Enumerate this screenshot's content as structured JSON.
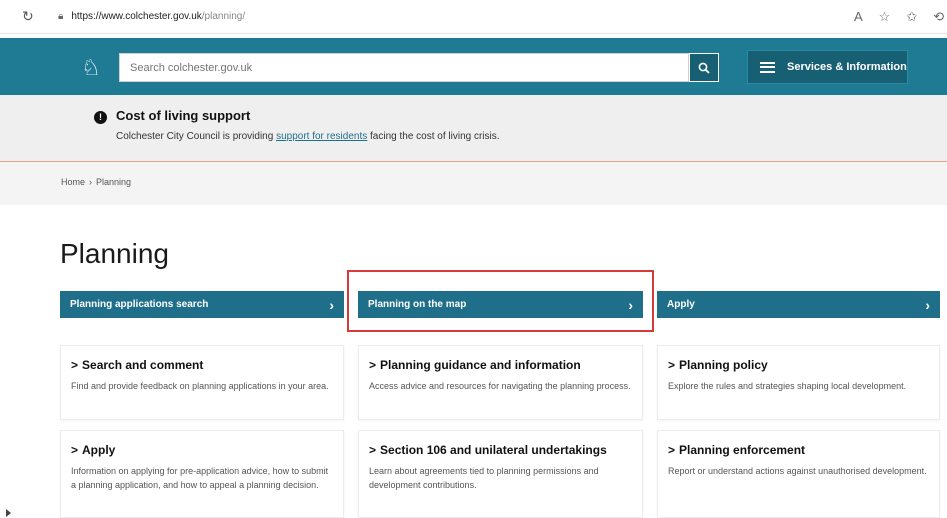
{
  "browser": {
    "url_host": "https://www.colchester.gov.uk",
    "url_path": "/planning/"
  },
  "header": {
    "search_placeholder": "Search colchester.gov.uk",
    "services_label": "Services & Information"
  },
  "alert": {
    "title": "Cost of living support",
    "text_before": "Colchester City Council is providing ",
    "link_text": "support for residents",
    "text_after": " facing the cost of living crisis."
  },
  "breadcrumb": {
    "home": "Home",
    "sep": "›",
    "current": "Planning"
  },
  "page": {
    "title": "Planning"
  },
  "bars": [
    {
      "label": "Planning applications search"
    },
    {
      "label": "Planning on the map"
    },
    {
      "label": "Apply"
    }
  ],
  "cards": [
    {
      "title": "Search and comment",
      "desc": "Find and provide feedback on planning applications in your area."
    },
    {
      "title": "Planning guidance and information",
      "desc": "Access advice and resources for navigating the planning process."
    },
    {
      "title": "Planning policy",
      "desc": "Explore the rules and strategies shaping local development."
    },
    {
      "title": "Apply",
      "desc": "Information on applying for pre-application advice, how to submit a planning application, and how to appeal a planning decision."
    },
    {
      "title": "Section 106 and unilateral undertakings",
      "desc": "Learn about agreements tied to planning permissions and development contributions."
    },
    {
      "title": "Planning enforcement",
      "desc": "Report or understand actions against unauthorised development."
    }
  ],
  "icons": {
    "chevron": "›",
    "card_chevron": ">",
    "alert": "!"
  },
  "colors": {
    "brand": "#1f7a93",
    "bar": "#1f6f8b",
    "highlight": "#d63b3b"
  }
}
